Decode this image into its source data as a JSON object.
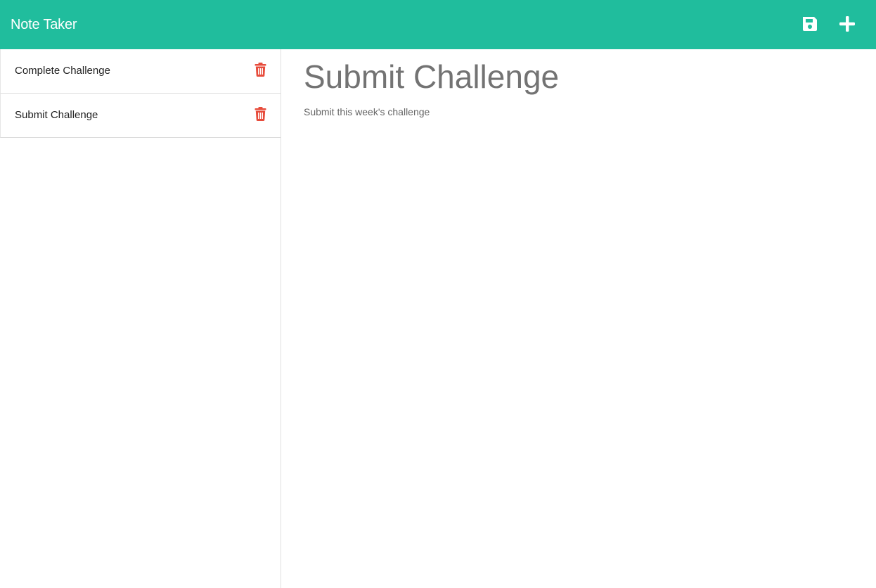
{
  "app": {
    "brand": "Note Taker",
    "accent_color": "#20bd9d",
    "delete_color": "#e74c3c"
  },
  "toolbar": {
    "save_icon": "save-icon",
    "add_icon": "plus-icon"
  },
  "sidebar": {
    "items": [
      {
        "label": "Complete Challenge",
        "icon": "trash-icon"
      },
      {
        "label": "Submit Challenge",
        "icon": "trash-icon"
      }
    ]
  },
  "editor": {
    "title": "Submit Challenge",
    "text": "Submit this week's challenge"
  }
}
